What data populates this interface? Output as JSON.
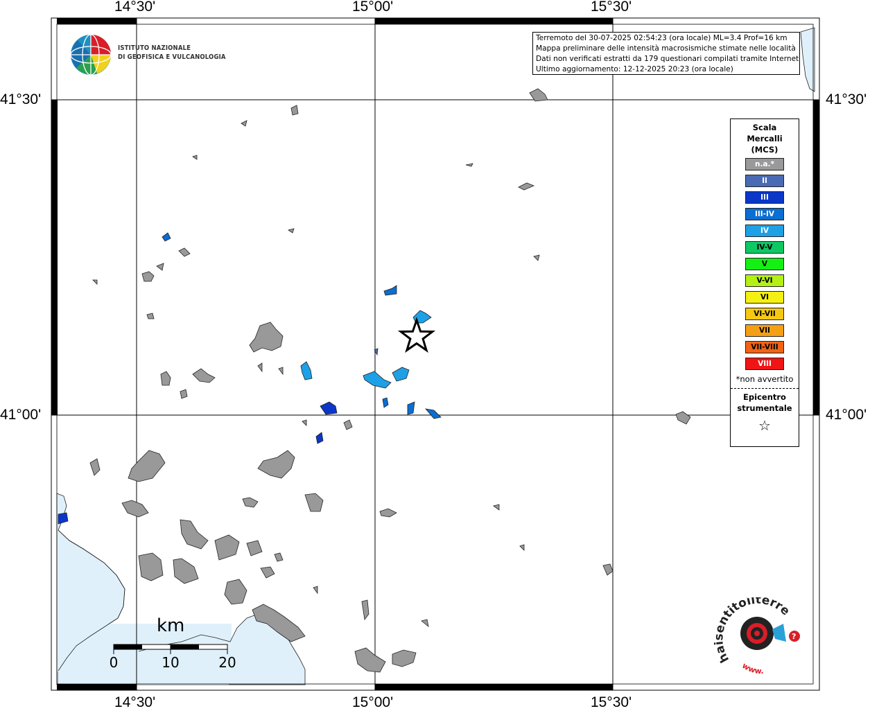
{
  "map": {
    "top_labels": [
      "14°30'",
      "15°00'",
      "15°30'"
    ],
    "bottom_labels": [
      "14°30'",
      "15°00'",
      "15°30'"
    ],
    "left_labels": [
      "41°30'",
      "41°00'"
    ],
    "right_labels": [
      "41°30'",
      "41°00'"
    ]
  },
  "info": {
    "line1": "Terremoto del 30-07-2025 02:54:23 (ora locale) ML=3.4 Prof=16 km",
    "line2": "Mappa preliminare delle intensità macrosismiche stimate nelle località",
    "line3": "Dati non verificati estratti da 179 questionari compilati tramite Internet.",
    "line4": "Ultimo aggiornamento: 12-12-2025 20:23 (ora locale)"
  },
  "logo": {
    "line1": "ISTITUTO NAZIONALE",
    "line2": "DI GEOFISICA E VULCANOLOGIA"
  },
  "legend": {
    "title_lines": [
      "Scala",
      "Mercalli",
      "(MCS)"
    ],
    "items": [
      {
        "label": "n.a.*",
        "color": "#999999",
        "text_color": "#ffffff"
      },
      {
        "label": "II",
        "color": "#4a6bb4",
        "text_color": "#ffffff"
      },
      {
        "label": "III",
        "color": "#0a37c8",
        "text_color": "#ffffff"
      },
      {
        "label": "III-IV",
        "color": "#0a6ed2",
        "text_color": "#ffffff"
      },
      {
        "label": "IV",
        "color": "#1ea0e6",
        "text_color": "#ffffff"
      },
      {
        "label": "IV-V",
        "color": "#0fc864",
        "text_color": "#000000"
      },
      {
        "label": "V",
        "color": "#14f014",
        "text_color": "#000000"
      },
      {
        "label": "V-VI",
        "color": "#b4f014",
        "text_color": "#000000"
      },
      {
        "label": "VI",
        "color": "#f5f014",
        "text_color": "#000000"
      },
      {
        "label": "VI-VII",
        "color": "#f5c814",
        "text_color": "#000000"
      },
      {
        "label": "VII",
        "color": "#f5a014",
        "text_color": "#000000"
      },
      {
        "label": "VII-VIII",
        "color": "#f06414",
        "text_color": "#000000"
      },
      {
        "label": "VIII",
        "color": "#f01414",
        "text_color": "#ffffff"
      }
    ],
    "note": "*non avvertito",
    "epicentre_lines": [
      "Epicentro",
      "strumentale"
    ],
    "star": "☆"
  },
  "scalebar": {
    "title": "km",
    "ticks": [
      "0",
      "10",
      "20"
    ]
  },
  "hst_logo": {
    "text": "haisentitoilterremoto.it",
    "sub": "www."
  }
}
